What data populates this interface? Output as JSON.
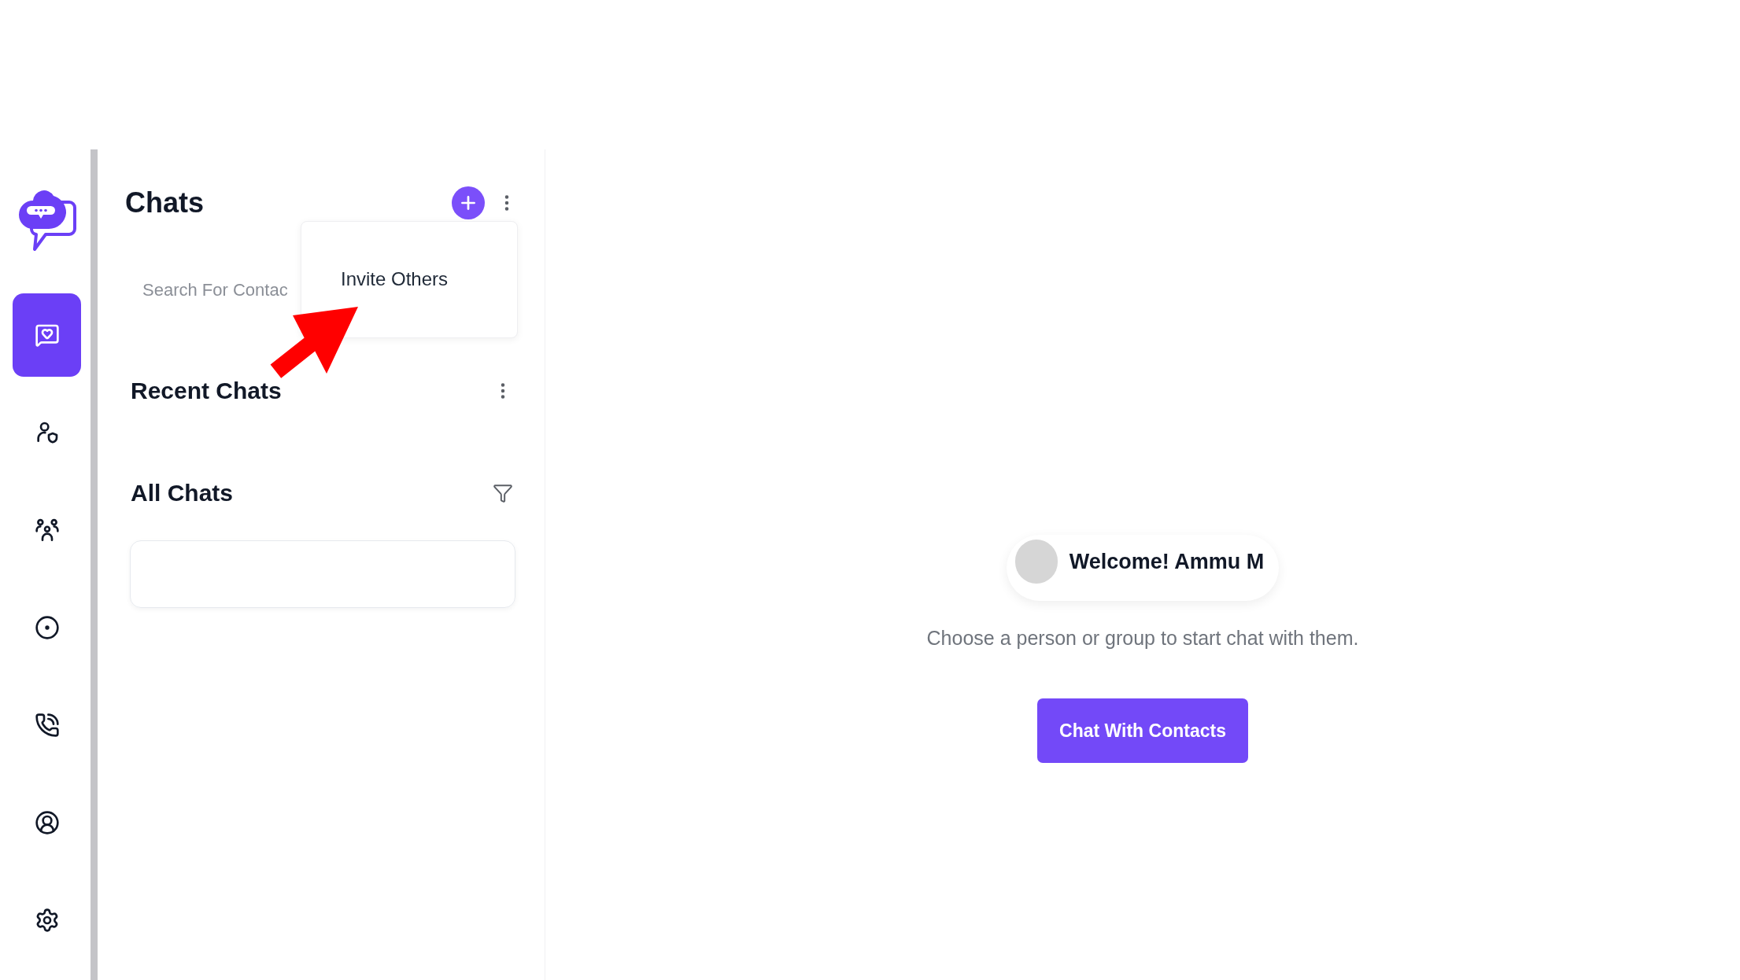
{
  "nav": {
    "items": [
      {
        "selected": true
      },
      {
        "selected": false
      },
      {
        "selected": false
      },
      {
        "selected": false
      },
      {
        "selected": false
      },
      {
        "selected": false
      },
      {
        "selected": false
      }
    ]
  },
  "chats_panel": {
    "title": "Chats",
    "search": {
      "placeholder": "Search For Contac"
    },
    "menu": {
      "open": true,
      "items": [
        "Invite Others"
      ]
    },
    "sections": [
      {
        "title": "Recent Chats",
        "kind": "options"
      },
      {
        "title": "All Chats",
        "kind": "filter"
      }
    ]
  },
  "welcome": {
    "greeting": "Welcome! Ammu M",
    "message": "Choose a person or group to start chat with them.",
    "button": "Chat With Contacts"
  }
}
